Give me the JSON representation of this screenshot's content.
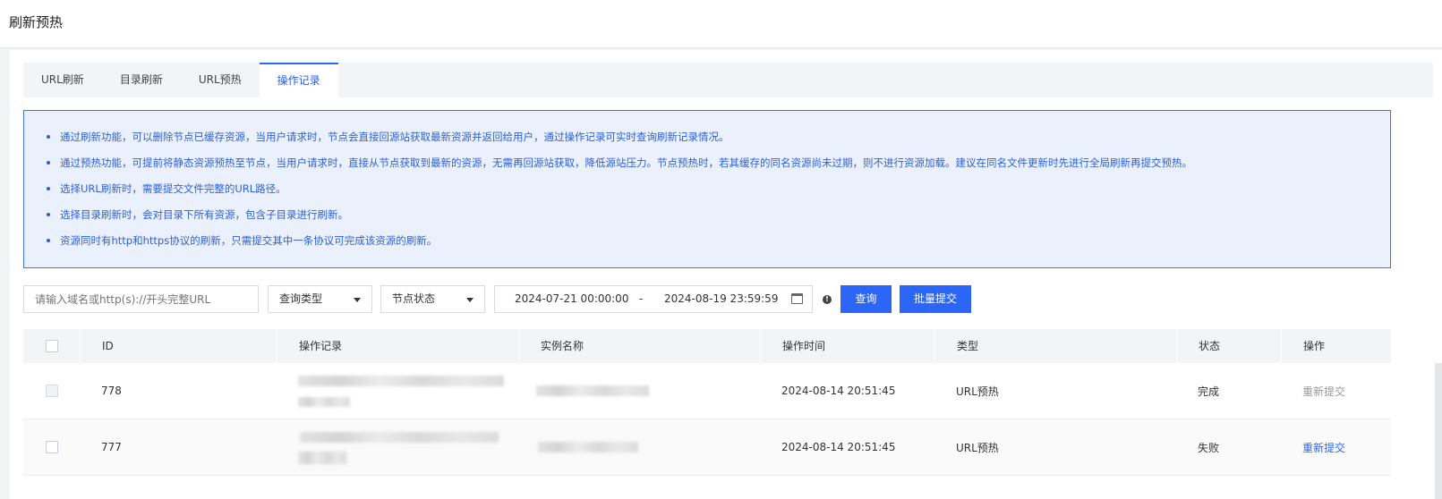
{
  "page": {
    "title": "刷新预热"
  },
  "tabs": [
    {
      "label": "URL刷新"
    },
    {
      "label": "目录刷新"
    },
    {
      "label": "URL预热"
    },
    {
      "label": "操作记录"
    }
  ],
  "notice": [
    "通过刷新功能，可以删除节点已缓存资源，当用户请求时，节点会直接回源站获取最新资源并返回给用户，通过操作记录可实时查询刷新记录情况。",
    "通过预热功能，可提前将静态资源预热至节点，当用户请求时，直接从节点获取到最新的资源，无需再回源站获取，降低源站压力。节点预热时，若其缓存的同名资源尚未过期，则不进行资源加载。建议在同名文件更新时先进行全局刷新再提交预热。",
    "选择URL刷新时，需要提交文件完整的URL路径。",
    "选择目录刷新时，会对目录下所有资源，包含子目录进行刷新。",
    "资源同时有http和https协议的刷新，只需提交其中一条协议可完成该资源的刷新。"
  ],
  "filters": {
    "search_placeholder": "请输入域名或http(s)://开头完整URL",
    "query_type": "查询类型",
    "node_status": "节点状态",
    "date_start": "2024-07-21 00:00:00",
    "date_sep": "-",
    "date_end": "2024-08-19 23:59:59",
    "info_glyph": "!",
    "query_button": "查询",
    "batch_button": "批量提交"
  },
  "table": {
    "headers": {
      "id": "ID",
      "record": "操作记录",
      "instance": "实例名称",
      "time": "操作时间",
      "type": "类型",
      "status": "状态",
      "action": "操作"
    },
    "rows": [
      {
        "id": "778",
        "time": "2024-08-14 20:51:45",
        "type": "URL预热",
        "status": "完成",
        "action": "重新提交",
        "action_enabled": false
      },
      {
        "id": "777",
        "time": "2024-08-14 20:51:45",
        "type": "URL预热",
        "status": "失败",
        "action": "重新提交",
        "action_enabled": true
      }
    ]
  }
}
